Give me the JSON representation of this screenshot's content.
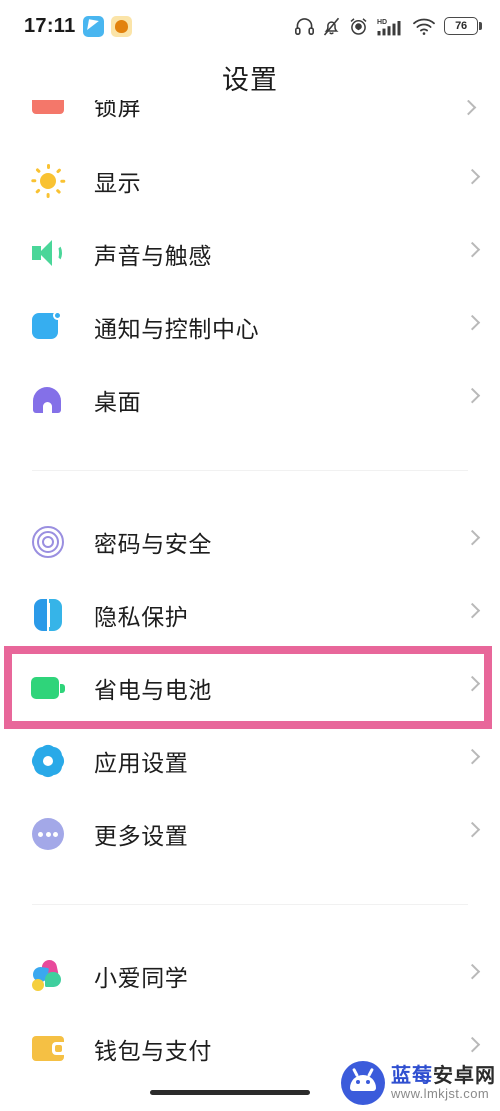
{
  "statusbar": {
    "time": "17:11",
    "battery_percent": "76",
    "icons": [
      "app-icon-blue",
      "app-icon-amber",
      "headphones-icon",
      "bell-muted-icon",
      "alarm-clock-icon",
      "hd-signal-icon",
      "wifi-icon",
      "battery-icon"
    ]
  },
  "header": {
    "title": "设置"
  },
  "sections": [
    {
      "items": [
        {
          "label": "锁屏",
          "icon": "lock-screen-icon",
          "clipped": true
        },
        {
          "label": "显示",
          "icon": "display-sun-icon",
          "clipped": false
        },
        {
          "label": "声音与触感",
          "icon": "sound-speaker-icon",
          "clipped": false
        },
        {
          "label": "通知与控制中心",
          "icon": "notification-icon",
          "clipped": false
        },
        {
          "label": "桌面",
          "icon": "home-screen-icon",
          "clipped": false
        }
      ]
    },
    {
      "items": [
        {
          "label": "密码与安全",
          "icon": "fingerprint-icon",
          "clipped": false
        },
        {
          "label": "隐私保护",
          "icon": "privacy-shield-icon",
          "clipped": false
        },
        {
          "label": "省电与电池",
          "icon": "battery-saver-icon",
          "clipped": false,
          "highlighted": true
        },
        {
          "label": "应用设置",
          "icon": "app-gear-icon",
          "clipped": false
        },
        {
          "label": "更多设置",
          "icon": "more-dots-icon",
          "clipped": false
        }
      ]
    },
    {
      "items": [
        {
          "label": "小爱同学",
          "icon": "xiaoai-assistant-icon",
          "clipped": false
        },
        {
          "label": "钱包与支付",
          "icon": "wallet-icon",
          "clipped": false
        }
      ]
    }
  ],
  "highlight": {
    "color": "#e8679a",
    "target": "省电与电池"
  },
  "watermark": {
    "title_a": "蓝莓",
    "title_b": "安卓网",
    "url": "www.lmkjst.com"
  }
}
